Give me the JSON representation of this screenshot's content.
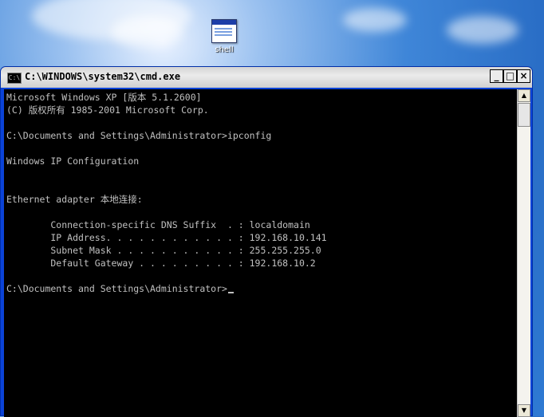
{
  "desktop": {
    "icon_label": "shell"
  },
  "window": {
    "title": "C:\\WINDOWS\\system32\\cmd.exe",
    "app_icon_text": "C:\\",
    "buttons": {
      "minimize": "_",
      "maximize": "□",
      "close": "×"
    }
  },
  "console": {
    "lines": [
      "Microsoft Windows XP [版本 5.1.2600]",
      "(C) 版权所有 1985-2001 Microsoft Corp.",
      "",
      "C:\\Documents and Settings\\Administrator>ipconfig",
      "",
      "Windows IP Configuration",
      "",
      "",
      "Ethernet adapter 本地连接:",
      "",
      "        Connection-specific DNS Suffix  . : localdomain",
      "        IP Address. . . . . . . . . . . . : 192.168.10.141",
      "        Subnet Mask . . . . . . . . . . . : 255.255.255.0",
      "        Default Gateway . . . . . . . . . : 192.168.10.2",
      "",
      "C:\\Documents and Settings\\Administrator>"
    ]
  },
  "scrollbar": {
    "up_arrow": "▲",
    "down_arrow": "▼"
  }
}
